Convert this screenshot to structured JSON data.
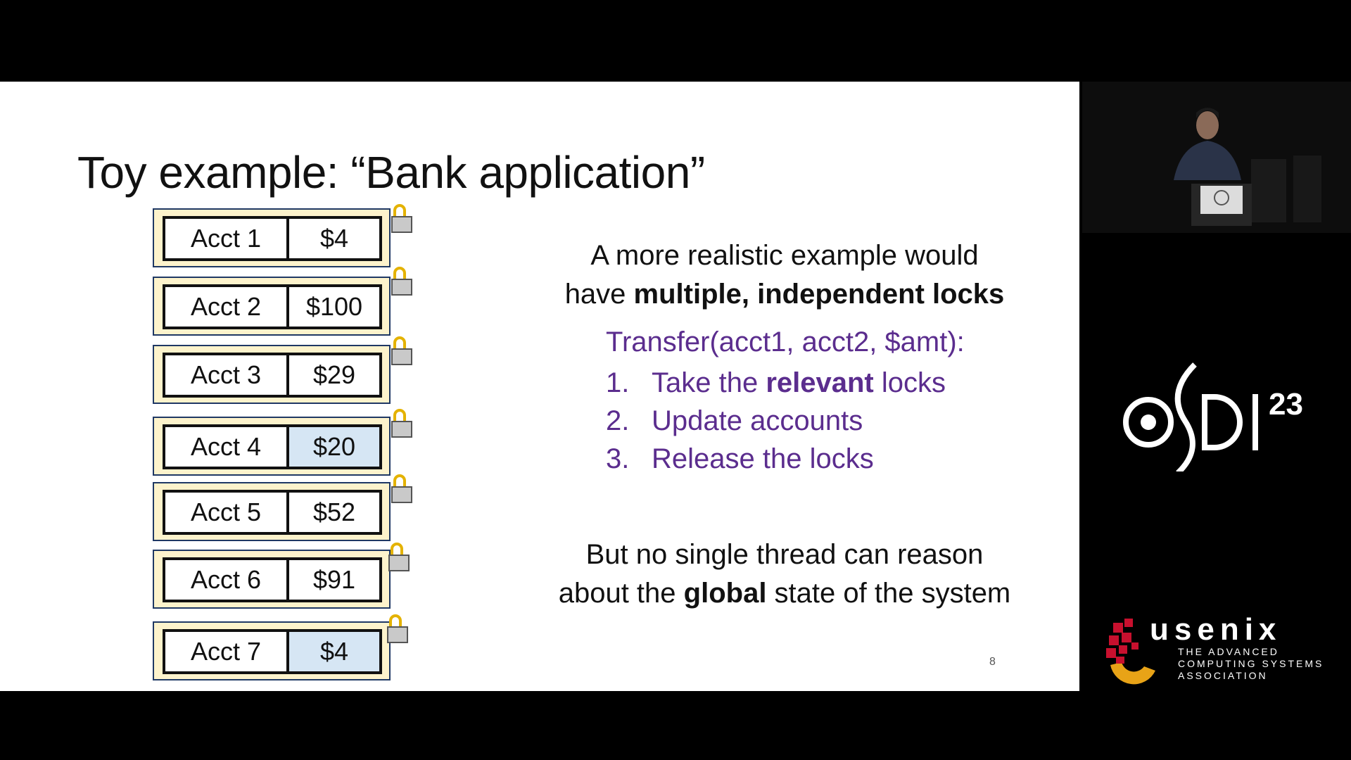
{
  "slide": {
    "title": "Toy example: “Bank application”",
    "accounts": [
      {
        "name": "Acct 1",
        "value": "$4",
        "highlighted": false
      },
      {
        "name": "Acct 2",
        "value": "$100",
        "highlighted": false
      },
      {
        "name": "Acct 3",
        "value": "$29",
        "highlighted": false
      },
      {
        "name": "Acct 4",
        "value": "$20",
        "highlighted": true
      },
      {
        "name": "Acct 5",
        "value": "$52",
        "highlighted": false
      },
      {
        "name": "Acct 6",
        "value": "$91",
        "highlighted": false
      },
      {
        "name": "Acct 7",
        "value": "$4",
        "highlighted": true
      }
    ],
    "para1": {
      "line1": "A more realistic example would",
      "line2_pre": "have ",
      "line2_bold": "multiple, independent locks"
    },
    "transfer_header": "Transfer(acct1, acct2, $amt):",
    "steps": [
      {
        "num": "1.",
        "pre": "Take the ",
        "bold": "relevant",
        "post": " locks"
      },
      {
        "num": "2.",
        "pre": "Update accounts",
        "bold": "",
        "post": ""
      },
      {
        "num": "3.",
        "pre": "Release the locks",
        "bold": "",
        "post": ""
      }
    ],
    "para2": {
      "line1": "But no single thread can reason",
      "line2_pre": "about the ",
      "line2_bold": "global",
      "line2_post": " state of the system"
    },
    "page_number": "8"
  },
  "branding": {
    "osdi_number": "23",
    "usenix_word": "usenix",
    "usenix_tagline": [
      "THE ADVANCED",
      "COMPUTING SYSTEMS",
      "ASSOCIATION"
    ]
  },
  "colors": {
    "purple": "#5b2d8e",
    "account_box": "#fdf3cc",
    "highlight": "#d6e6f4",
    "lock_shackle": "#e4b200"
  }
}
